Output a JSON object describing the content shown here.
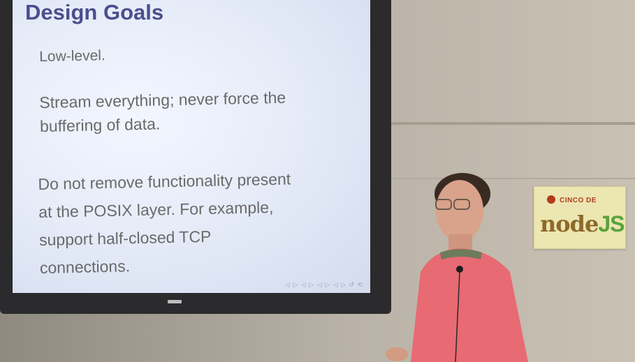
{
  "slide": {
    "title": "Design Goals",
    "bullets": [
      "Low-level.",
      "Stream everything; never force the\nbuffering of data.",
      "Do not remove functionality present\nat the POSIX layer. For example,\nsupport half-closed TCP\nconnections."
    ]
  },
  "sticker": {
    "line1": "CINCO DE",
    "brand": "node",
    "brand_suffix": "JS"
  },
  "colors": {
    "slide_title": "#4b4f8e",
    "slide_text": "#6a6a6a",
    "shirt": "#e86a73",
    "collar": "#6e7b5c"
  }
}
